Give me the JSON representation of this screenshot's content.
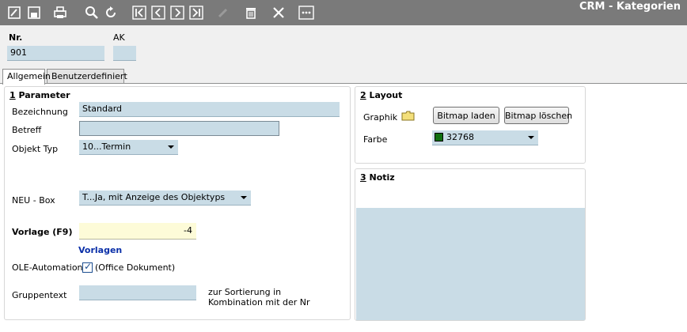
{
  "window": {
    "title": "CRM - Kategorien"
  },
  "toolbar": {
    "buttons": [
      "edit-icon",
      "save-icon",
      "print-icon",
      "search-icon",
      "refresh-icon",
      "first-record-icon",
      "previous-record-icon",
      "next-record-icon",
      "last-record-icon",
      "pencil-icon",
      "delete-icon",
      "close-icon",
      "more-icon"
    ]
  },
  "header": {
    "nr_label": "Nr.",
    "nr_value": "901",
    "ak_label": "AK",
    "ak_value": ""
  },
  "tabs": [
    {
      "label": "Allgemein",
      "active": true
    },
    {
      "label": "Benutzerdefiniert",
      "active": false
    }
  ],
  "parameter": {
    "title_num": "1",
    "title_text": " Parameter",
    "bezeichnung_label": "Bezeichnung",
    "bezeichnung_value": "Standard",
    "betreff_label": "Betreff",
    "betreff_value": "",
    "objekt_typ_label": "Objekt Typ",
    "objekt_typ_value": "10...Termin",
    "neu_box_label": "NEU - Box",
    "neu_box_value": "T...Ja, mit Anzeige des Objektyps",
    "vorlage_label": "Vorlage (F9)",
    "vorlage_value": "-4",
    "vorlagen_link": "Vorlagen",
    "ole_label": "OLE-Automation",
    "ole_checked": true,
    "ole_check_label": "(Office Dokument)",
    "gruppentext_label": "Gruppentext",
    "gruppentext_value": "",
    "gruppentext_hint_1": "zur Sortierung in",
    "gruppentext_hint_2": "Kombination mit der Nr"
  },
  "layout": {
    "title_num": "2",
    "title_text": " Layout",
    "graphik_label": "Graphik",
    "bitmap_laden": "Bitmap laden",
    "bitmap_loeschen": "Bitmap löschen",
    "farbe_label": "Farbe",
    "farbe_value": "32768",
    "farbe_color": "#107010"
  },
  "notiz": {
    "title_num": "3",
    "title_text": " Notiz",
    "value": ""
  },
  "colors": {
    "toolbar_bg": "#7a7a7a",
    "field_bg": "#c9dce6",
    "vorlage_bg": "#fdfbd8",
    "link": "#0a2fa8"
  }
}
